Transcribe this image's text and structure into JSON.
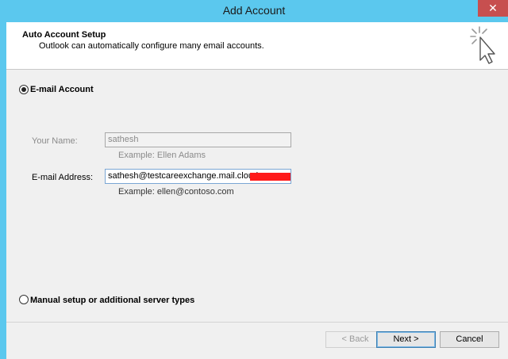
{
  "window": {
    "title": "Add Account",
    "close_glyph": "✕"
  },
  "header": {
    "title": "Auto Account Setup",
    "subtitle": "Outlook can automatically configure many email accounts.",
    "icon": "cursor-sparkle-icon"
  },
  "options": {
    "email_account_label": "E-mail Account",
    "email_account_selected": true,
    "manual_setup_label": "Manual setup or additional server types",
    "manual_setup_selected": false
  },
  "form": {
    "name_label": "Your Name:",
    "name_value": "sathesh",
    "name_example": "Example: Ellen Adams",
    "email_label": "E-mail Address:",
    "email_value": "sathesh@testcareexchange.mail.cloud",
    "email_example": "Example: ellen@contoso.com"
  },
  "buttons": {
    "back": "< Back",
    "next": "Next >",
    "cancel": "Cancel"
  },
  "colors": {
    "titlebar": "#5bc8ee",
    "close_button": "#c74f4f",
    "redaction": "#ff1a1a"
  }
}
